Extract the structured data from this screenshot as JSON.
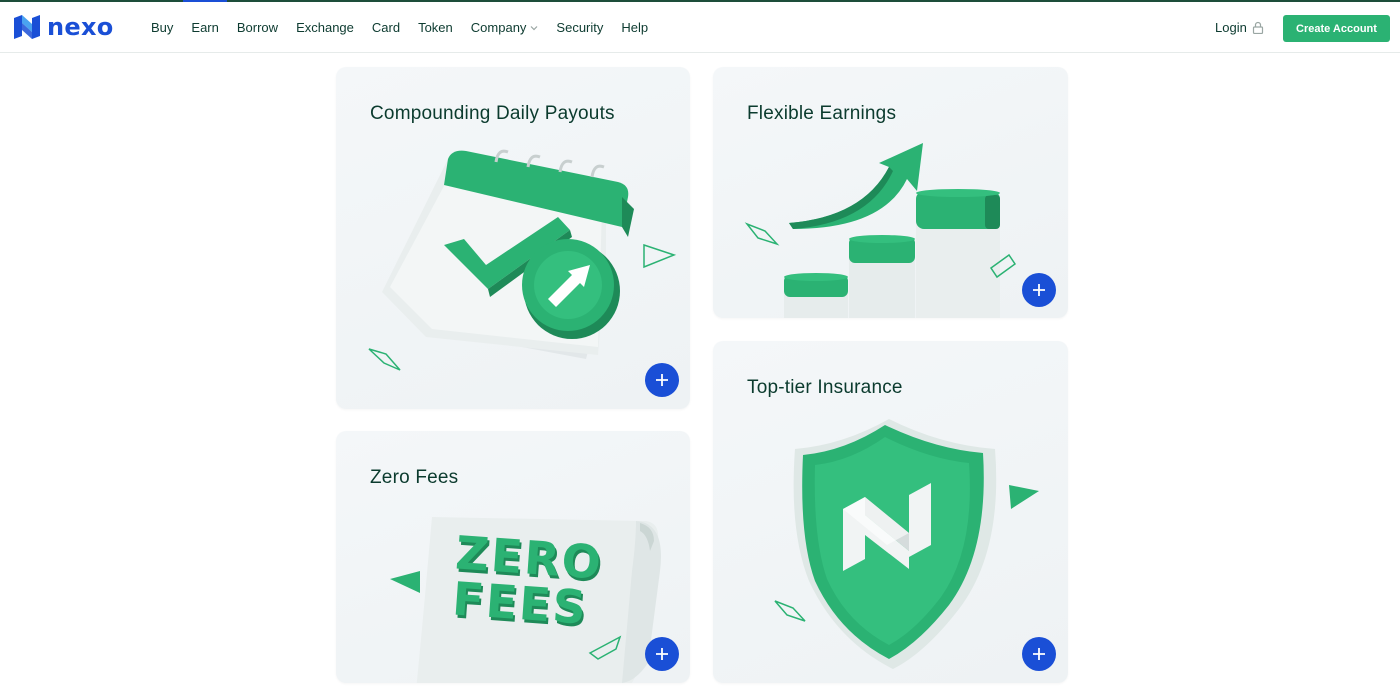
{
  "brand": {
    "name": "nexo",
    "color": "#1a4fd6",
    "logo_icon": "nexo-logo-icon"
  },
  "nav": {
    "items": [
      {
        "label": "Buy"
      },
      {
        "label": "Earn",
        "active": true
      },
      {
        "label": "Borrow"
      },
      {
        "label": "Exchange"
      },
      {
        "label": "Card"
      },
      {
        "label": "Token"
      },
      {
        "label": "Company",
        "icon": "chevron-down-icon"
      },
      {
        "label": "Security"
      },
      {
        "label": "Help"
      }
    ]
  },
  "auth": {
    "login_label": "Login",
    "login_icon": "lock-icon",
    "create_account_label": "Create Account"
  },
  "cards": {
    "compounding": {
      "title": "Compounding Daily Payouts",
      "icon": "calendar-check-arrow-icon"
    },
    "flexible": {
      "title": "Flexible Earnings",
      "icon": "growth-bars-arrow-icon"
    },
    "zero_fees": {
      "title": "Zero Fees",
      "icon": "zero-fees-scroll-icon",
      "art_text_line1": "ZERO",
      "art_text_line2": "FEES"
    },
    "insurance": {
      "title": "Top-tier Insurance",
      "icon": "shield-icon"
    }
  },
  "colors": {
    "accent_green": "#2bb273",
    "button_blue": "#1a4fd6",
    "text_dark": "#0b3b2e"
  }
}
